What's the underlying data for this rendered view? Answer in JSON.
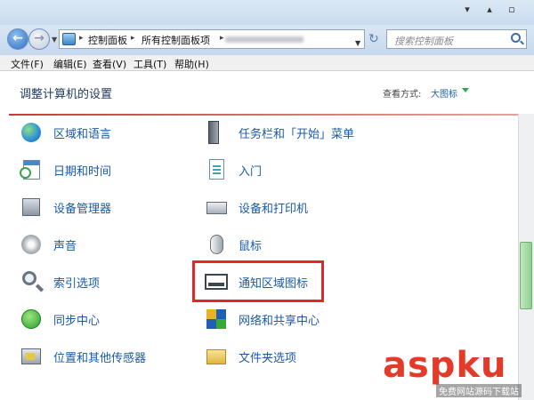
{
  "window": {
    "minimize_glyph": "▾",
    "maximize_glyph": "▴",
    "restore_glyph": "▫"
  },
  "address": {
    "crumbs": [
      "控制面板",
      "所有控制面板项"
    ],
    "separator": "▸"
  },
  "search": {
    "placeholder": "搜索控制面板"
  },
  "menu": {
    "items": [
      "文件(F)",
      "编辑(E)",
      "查看(V)",
      "工具(T)",
      "帮助(H)"
    ]
  },
  "header": {
    "title": "调整计算机的设置",
    "view_by_label": "查看方式:",
    "view_by_value": "大图标"
  },
  "items": {
    "left": [
      {
        "label": "区域和语言",
        "icon": "globe-icon"
      },
      {
        "label": "日期和时间",
        "icon": "calendar-clock-icon"
      },
      {
        "label": "设备管理器",
        "icon": "device-manager-icon"
      },
      {
        "label": "声音",
        "icon": "speaker-icon"
      },
      {
        "label": "索引选项",
        "icon": "magnifier-icon"
      },
      {
        "label": "同步中心",
        "icon": "sync-icon"
      },
      {
        "label": "位置和其他传感器",
        "icon": "sensor-icon"
      }
    ],
    "right": [
      {
        "label": "任务栏和「开始」菜单",
        "icon": "taskbar-icon"
      },
      {
        "label": "入门",
        "icon": "getting-started-icon"
      },
      {
        "label": "设备和打印机",
        "icon": "printer-icon"
      },
      {
        "label": "鼠标",
        "icon": "mouse-icon"
      },
      {
        "label": "通知区域图标",
        "icon": "notification-tray-icon"
      },
      {
        "label": "网络和共享中心",
        "icon": "network-icon"
      },
      {
        "label": "文件夹选项",
        "icon": "folder-icon"
      }
    ]
  },
  "watermark": {
    "text": "aspku",
    "sub": "免费网站源码下载站"
  },
  "colors": {
    "highlight_box": "#e0282a",
    "link_text": "#1a5aa7"
  }
}
